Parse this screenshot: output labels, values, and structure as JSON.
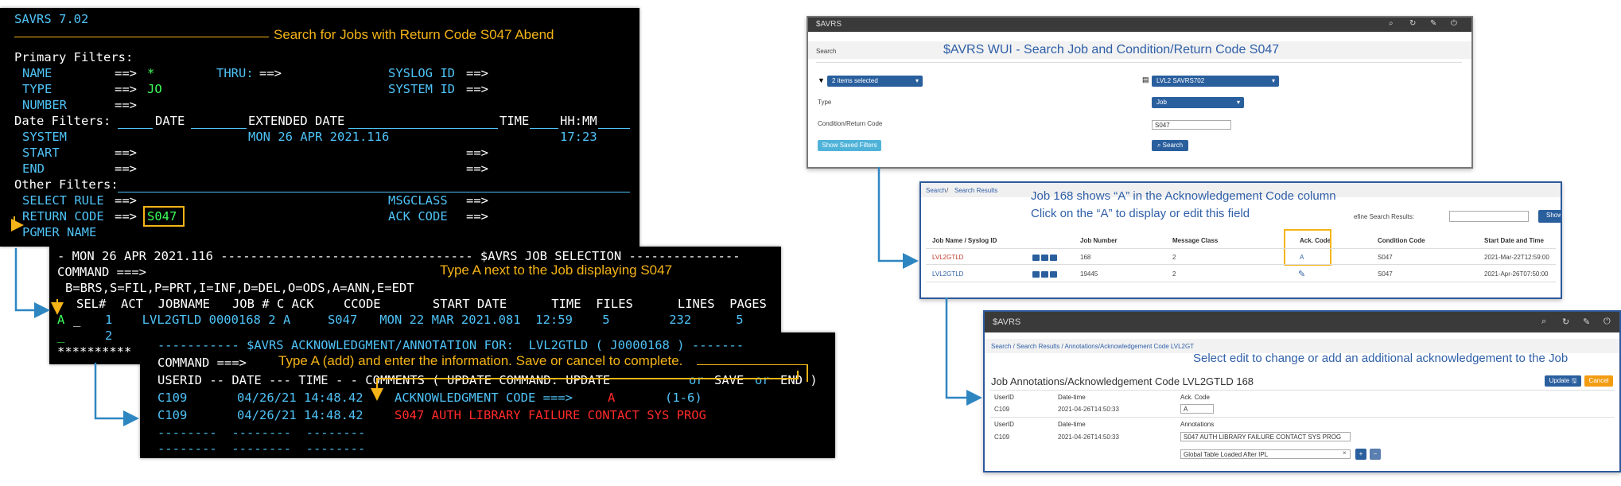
{
  "screen1": {
    "title": "SAVRS 7.02",
    "annotation": "Search for Jobs with Return Code S047 Abend",
    "primary_filters": "Primary Filters:",
    "name_label": "NAME",
    "arrow": "==>",
    "name_value": "*",
    "thru_label": "THRU:",
    "syslog_label": "SYSLOG ID",
    "type_label": "TYPE",
    "type_value": "JO",
    "system_id_label": "SYSTEM ID",
    "number_label": "NUMBER",
    "date_filters": "Date Filters:",
    "date_col": "DATE",
    "extended_date_col": "EXTENDED DATE",
    "time_col": "TIME",
    "hhmm_col": "HH:MM",
    "system_label": "SYSTEM",
    "system_date": "MON 26 APR 2021.116",
    "system_time": "17:23",
    "start_label": "START",
    "end_label": "END",
    "other_filters": "Other Filters:",
    "select_rule_label": "SELECT RULE",
    "msgclass_label": "MSGCLASS",
    "return_code_label": "RETURN CODE",
    "return_code_value": "S047",
    "ack_code_label": "ACK CODE",
    "pgmer_label": "PGMER NAME"
  },
  "screen2": {
    "header": "- MON 26 APR 2021.116 ---------------------------------- $AVRS JOB SELECTION ---------------",
    "command": "COMMAND ===>",
    "annotation": "Type A next to the Job displaying S047",
    "legend": "B=BRS,S=FIL,P=PRT,I=INF,D=DEL,O=ODS,A=ANN,E=EDT",
    "columns": "SEL#  ACT  JOBNAME   JOB # C ACK    CCODE       START DATE      TIME  FILES      LINES  PAGES",
    "row1_sel": "A",
    "row1": "1    LVL2GTLD 0000168 2 A     S047   MON 22 MAR 2021.081  12:59    5        232      5",
    "row2": "2",
    "stars": "**********"
  },
  "screen3": {
    "header": "----------- $AVRS ACKNOWLEDGMENT/ANNOTATION FOR:  LVL2GTLD ( J0000168 ) -------",
    "command": "COMMAND ===>",
    "annotation": "Type A (add) and enter the information.  Save or cancel to complete.",
    "columns_a": "USERID -- DATE --- TIME - - COMMENTS ( UPDATE COMMAND: UPDATE",
    "or1": "or",
    "save": "SAVE",
    "or2": "or",
    "end": "END )",
    "r1_user": "C109",
    "r1_date": "04/26/21 14:48.42",
    "r1_label": "ACKNOWLEDGMENT CODE ===>",
    "r1_value": "A",
    "r1_range": "(1-6)",
    "r2_user": "C109",
    "r2_date": "04/26/21 14:48.42",
    "r2_comment": "S047 AUTH LIBRARY FAILURE CONTACT SYS PROG",
    "dashes": "--------  --------  --------"
  },
  "wui1": {
    "brand": "$AVRS",
    "search_label": "Search",
    "annotation": "$AVRS WUI - Search Job and Condition/Return Code S047",
    "filter_dd": "2 items selected",
    "env_dd": "LVL2 SAVRS702",
    "type_label": "Type",
    "type_dd": "Job",
    "cond_label": "Condition/Return Code",
    "cond_value": "S047",
    "show_saved": "Show Saved Filters",
    "search_btn": "Search"
  },
  "wui2": {
    "bc_search": "Search",
    "bc_results": "Search Results",
    "annotation_1": "Job 168 shows “A” in the Acknowledgement Code column",
    "annotation_2": "Click on the “A” to display or edit this field",
    "refine_label": "efine Search Results:",
    "show_btn": "Show",
    "col_job": "Job Name / Syslog ID",
    "col_number": "Job Number",
    "col_class": "Message Class",
    "col_ack": "Ack. Code",
    "col_cond": "Condition Code",
    "col_start": "Start Date and Time",
    "rows": [
      {
        "job": "LVL2GTLD",
        "number": "168",
        "class": "2",
        "ack": "A",
        "cond": "S047",
        "start": "2021-Mar-22T12:59:00"
      },
      {
        "job": "LVL2GTLD",
        "number": "19445",
        "class": "2",
        "ack": "",
        "cond": "S047",
        "start": "2021-Apr-26T07:50:00"
      }
    ]
  },
  "wui3": {
    "brand": "$AVRS",
    "bc": "Search  /  Search Results  /  Annotations/Acknowledgement Code LVL2GT",
    "annotation": "Select edit to change or add an additional acknowledgement to the Job",
    "title": "Job Annotations/Acknowledgement Code LVL2GTLD 168",
    "update_btn": "Update",
    "cancel_btn": "Cancel",
    "userid": "UserID",
    "datetime": "Date-time",
    "ack_code": "Ack. Code",
    "annotations": "Annotations",
    "r1_user": "C109",
    "r1_date": "2021-04-26T14:50:33",
    "r1_ack": "A",
    "r2_user": "C109",
    "r2_date": "2021-04-26T14:50:33",
    "r2_ann": "S047 AUTH LIBRARY FAILURE CONTACT SYS PROG",
    "r2_ann2": "Global Table Loaded After IPL"
  }
}
